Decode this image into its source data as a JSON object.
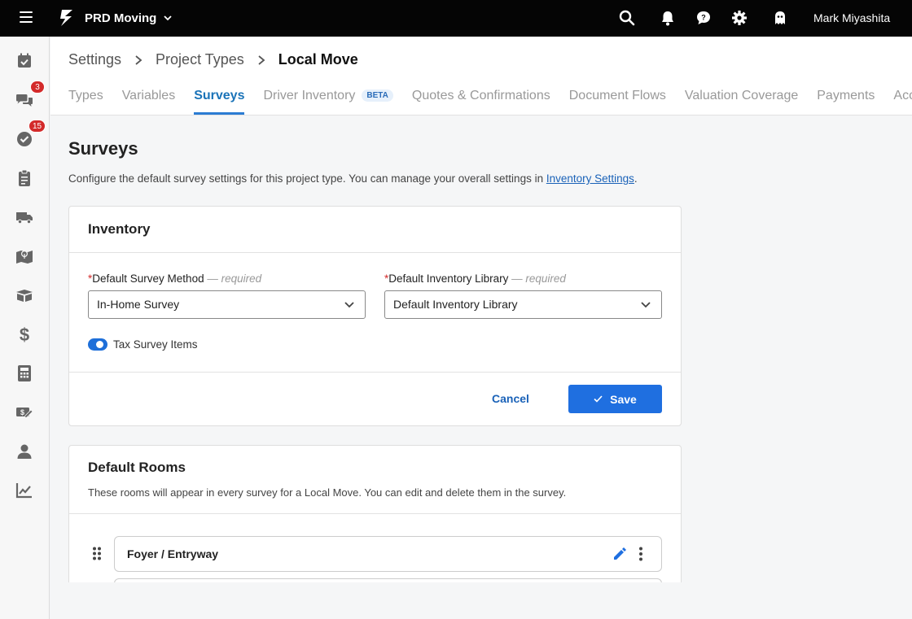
{
  "topbar": {
    "company": "PRD Moving",
    "user_name": "Mark Miyashita",
    "icons": [
      "menu-icon",
      "logo-icon",
      "search-icon",
      "bell-icon",
      "chat-icon",
      "gear-icon",
      "ghost-icon"
    ]
  },
  "sidebar": {
    "items": [
      {
        "icon": "calendar-check-icon"
      },
      {
        "icon": "chat-bubbles-icon",
        "badge": "3"
      },
      {
        "icon": "check-circle-icon",
        "badge": "15"
      },
      {
        "icon": "clipboard-icon"
      },
      {
        "icon": "truck-icon"
      },
      {
        "icon": "map-icon"
      },
      {
        "icon": "boxes-icon"
      },
      {
        "icon": "dollar-icon"
      },
      {
        "icon": "calculator-icon"
      },
      {
        "icon": "money-edit-icon"
      },
      {
        "icon": "user-icon"
      },
      {
        "icon": "chart-icon"
      }
    ]
  },
  "breadcrumb": {
    "items": [
      "Settings",
      "Project Types",
      "Local Move"
    ]
  },
  "tabs": [
    {
      "label": "Types"
    },
    {
      "label": "Variables"
    },
    {
      "label": "Surveys",
      "active": true
    },
    {
      "label": "Driver Inventory",
      "badge": "BETA"
    },
    {
      "label": "Quotes & Confirmations"
    },
    {
      "label": "Document Flows"
    },
    {
      "label": "Valuation Coverage"
    },
    {
      "label": "Payments"
    },
    {
      "label": "Acc"
    }
  ],
  "page": {
    "title": "Surveys",
    "description": "Configure the default survey settings for this project type. You can manage your overall settings in ",
    "description_link": "Inventory Settings",
    "description_end": "."
  },
  "inventory": {
    "title": "Inventory",
    "survey_method_label": "Default Survey Method",
    "survey_method_required": "— required",
    "survey_method_value": "In-Home Survey",
    "library_label": "Default Inventory Library",
    "library_required": "— required",
    "library_value": "Default Inventory Library",
    "toggle_label": "Tax Survey Items",
    "toggle_on": true,
    "cancel_label": "Cancel",
    "save_label": "Save"
  },
  "rooms": {
    "title": "Default Rooms",
    "description": "These rooms will appear in every survey for a Local Move. You can edit and delete them in the survey.",
    "items": [
      "Foyer / Entryway"
    ]
  },
  "colors": {
    "accent": "#1f6fe0",
    "badge": "#d32a2a",
    "topbar": "#050505"
  }
}
